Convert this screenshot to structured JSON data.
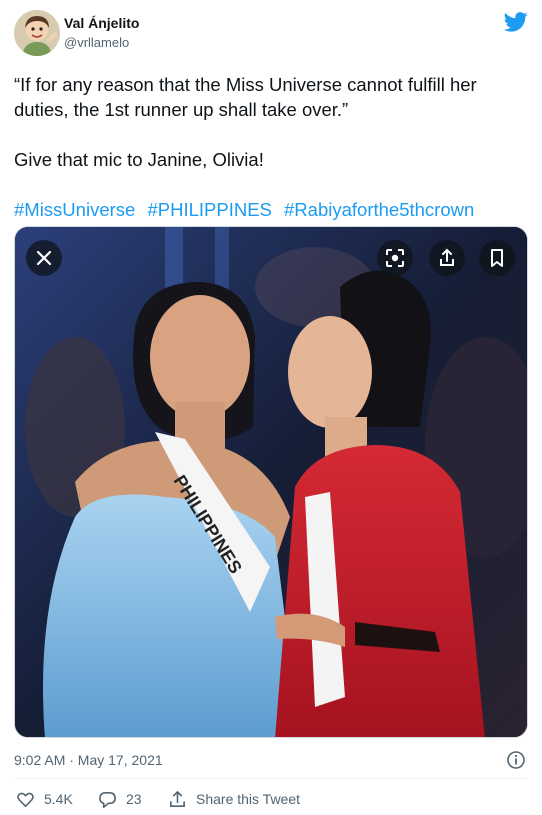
{
  "author": {
    "display_name": "Val Ánjelito",
    "handle": "@vrllamelo",
    "avatar_icon": "cartoon-avatar"
  },
  "tweet": {
    "paragraphs": [
      "“If for any reason that the Miss Universe cannot fulfill her duties, the 1st runner up shall take over.”",
      "Give that mic to Janine, Olivia!"
    ],
    "hashtags": [
      "#MissUniverse",
      "#PHILIPPINES",
      "#Rabiyaforthe5thcrown"
    ]
  },
  "media": {
    "sash_text": "PHILIPPINES",
    "controls": [
      "close-icon",
      "scan-icon",
      "share-icon",
      "bookmark-icon"
    ]
  },
  "meta": {
    "timestamp": "9:02 AM · May 17, 2021"
  },
  "actions": {
    "likes": "5.4K",
    "replies": "23",
    "share_label": "Share this Tweet"
  },
  "colors": {
    "accent": "#1d9bf0",
    "text": "#0f1419",
    "secondary": "#536471"
  }
}
